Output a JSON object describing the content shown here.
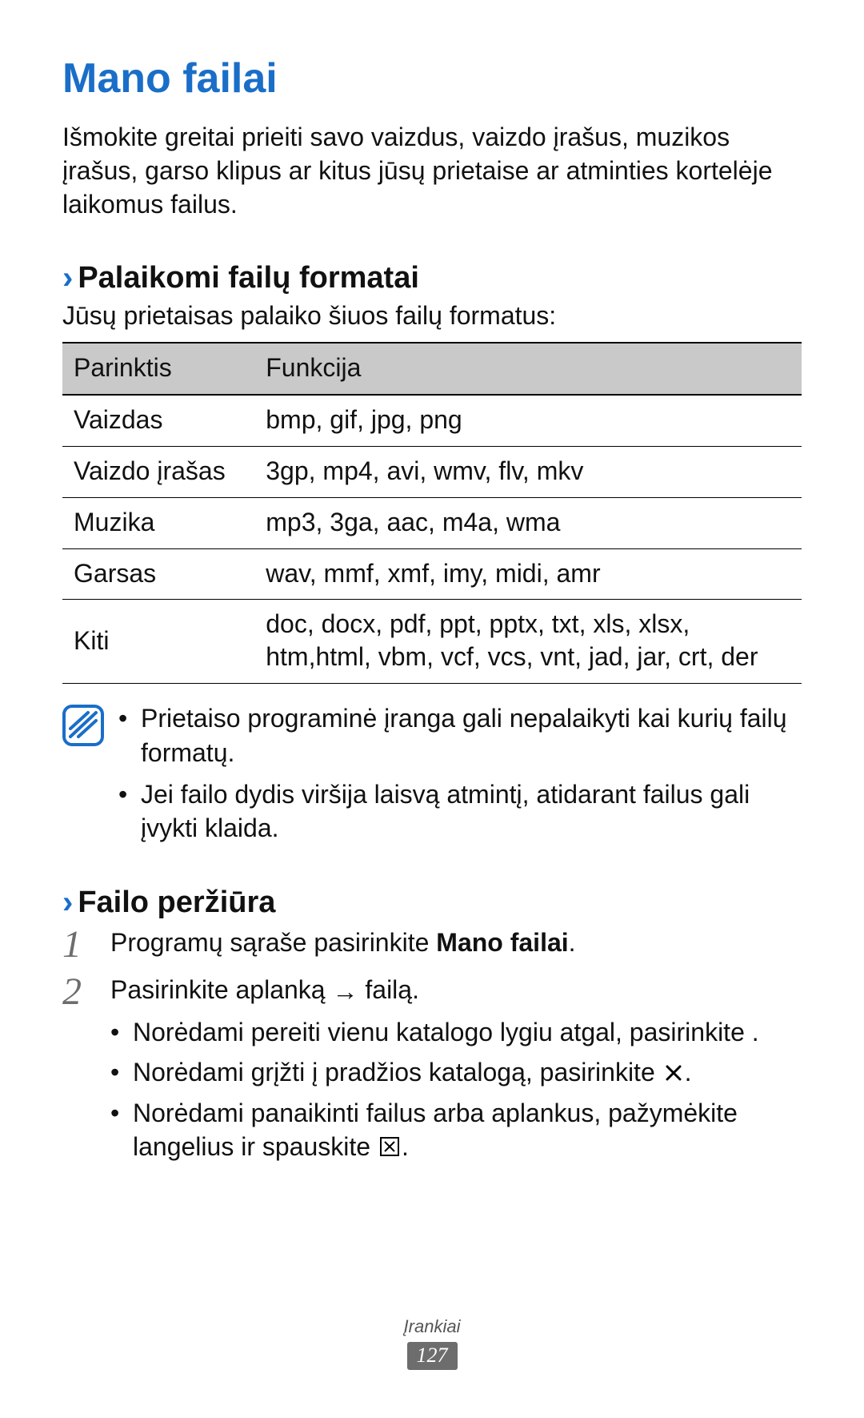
{
  "title": "Mano failai",
  "intro": "Išmokite greitai prieiti savo vaizdus, vaizdo įrašus, muzikos įrašus, garso klipus ar kitus jūsų prietaise ar atminties kortelėje laikomus failus.",
  "section1": {
    "heading": "Palaikomi failų formatai",
    "intro": "Jūsų prietaisas palaiko šiuos failų formatus:",
    "table": {
      "head_option": "Parinktis",
      "head_function": "Funkcija",
      "rows": [
        {
          "opt": "Vaizdas",
          "fn": "bmp, gif, jpg, png"
        },
        {
          "opt": "Vaizdo įrašas",
          "fn": "3gp, mp4, avi, wmv, flv, mkv"
        },
        {
          "opt": "Muzika",
          "fn": "mp3, 3ga, aac, m4a, wma"
        },
        {
          "opt": "Garsas",
          "fn": "wav, mmf, xmf, imy, midi, amr"
        },
        {
          "opt": "Kiti",
          "fn": "doc, docx, pdf, ppt, pptx, txt, xls, xlsx, htm,html, vbm, vcf, vcs, vnt, jad, jar, crt, der"
        }
      ]
    },
    "notes": [
      "Prietaiso programinė įranga gali nepalaikyti kai kurių failų formatų.",
      "Jei failo dydis viršija laisvą atmintį, atidarant failus gali įvykti klaida."
    ]
  },
  "section2": {
    "heading": "Failo peržiūra",
    "step1_pre": "Programų sąraše pasirinkite ",
    "step1_bold": "Mano failai",
    "step1_post": ".",
    "step2_pre": "Pasirinkite aplanką ",
    "step2_post": " failą.",
    "sub1": "Norėdami pereiti vienu katalogo lygiu atgal, pasirinkite       .",
    "sub2_pre": "Norėdami grįžti į pradžios katalogą, pasirinkite ",
    "sub2_post": ".",
    "sub3_pre": "Norėdami panaikinti failus arba aplankus, pažymėkite langelius ir spauskite ",
    "sub3_post": "."
  },
  "footer": {
    "category": "Įrankiai",
    "page": "127"
  }
}
